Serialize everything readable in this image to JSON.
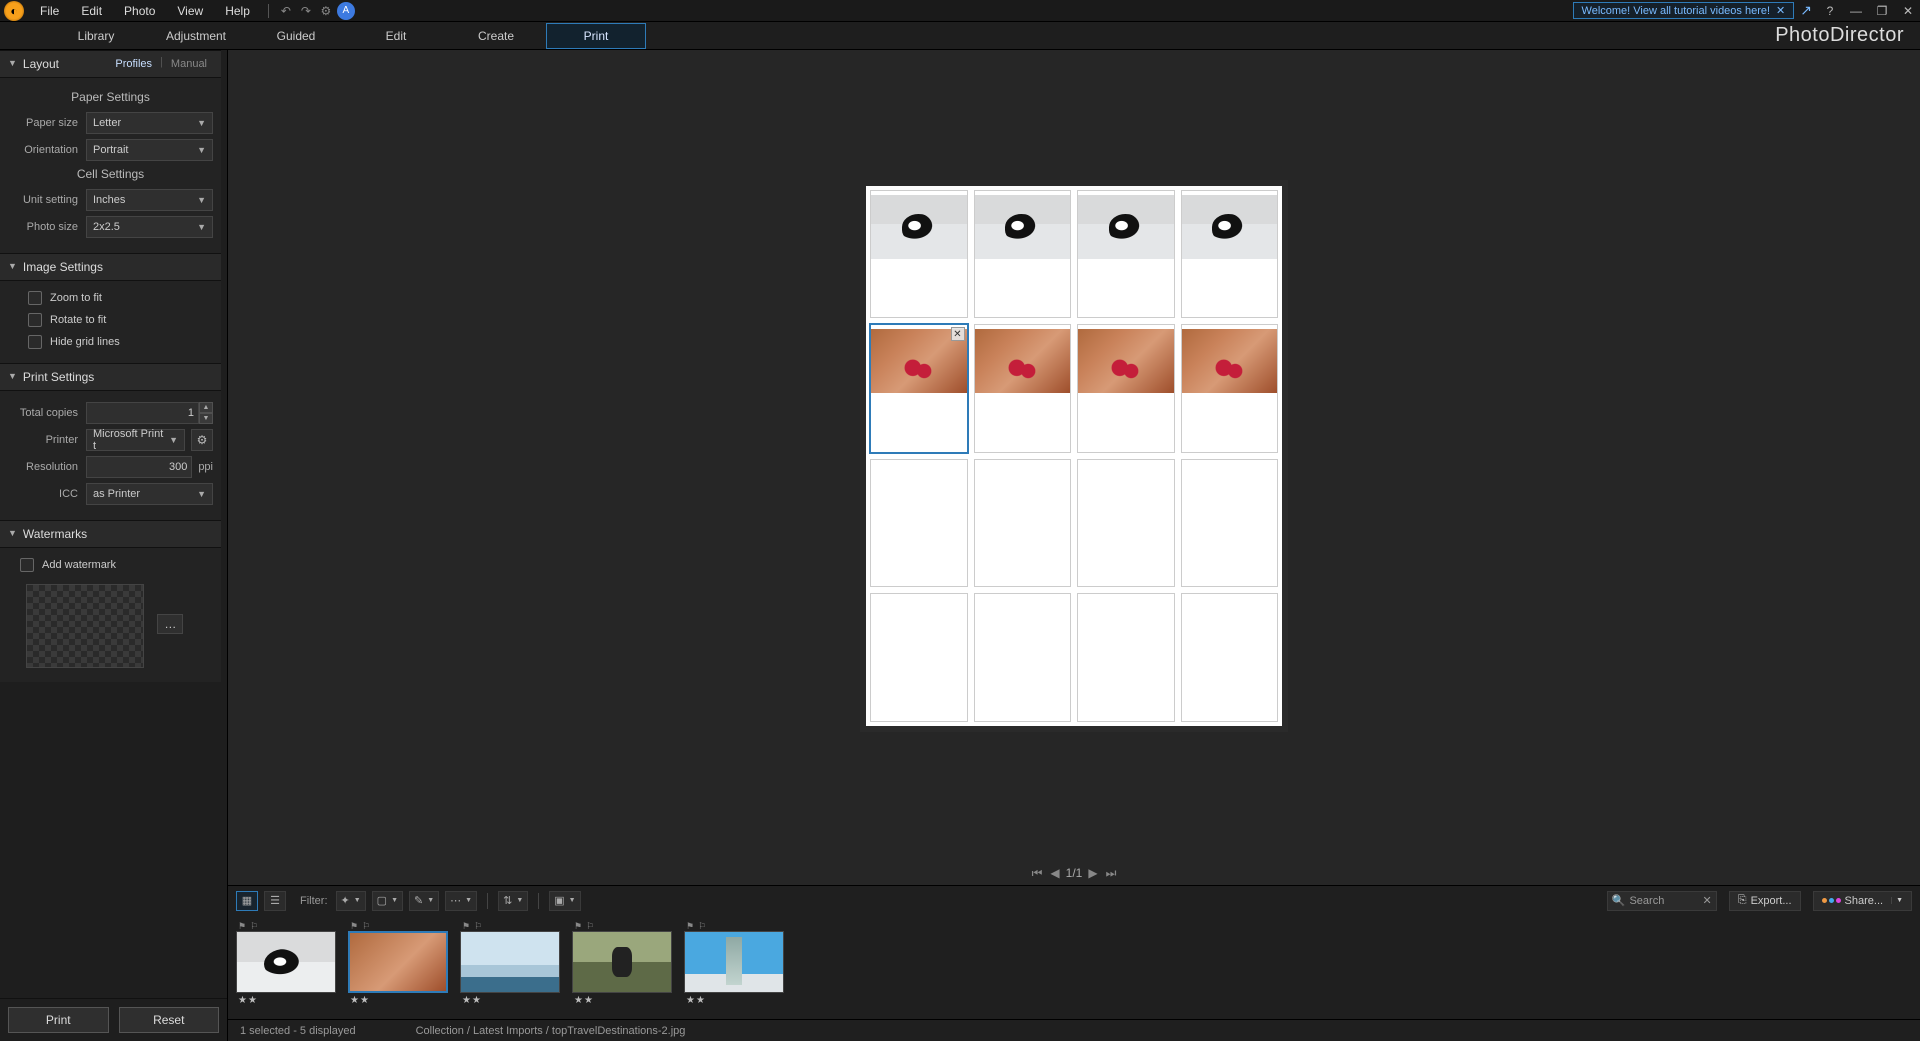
{
  "menubar": {
    "items": [
      "File",
      "Edit",
      "Photo",
      "View",
      "Help"
    ],
    "tutorial_pill": "Welcome! View all tutorial videos here!"
  },
  "modules": {
    "tabs": [
      "Library",
      "Adjustment",
      "Guided",
      "Edit",
      "Create",
      "Print"
    ],
    "active": "Print",
    "brand": "PhotoDirector"
  },
  "left": {
    "layout": {
      "title": "Layout",
      "subtabs": {
        "profiles": "Profiles",
        "manual": "Manual",
        "active": "Profiles"
      },
      "paper_settings_heading": "Paper Settings",
      "paper_size": {
        "label": "Paper size",
        "value": "Letter"
      },
      "orientation": {
        "label": "Orientation",
        "value": "Portrait"
      },
      "cell_settings_heading": "Cell Settings",
      "unit_setting": {
        "label": "Unit setting",
        "value": "Inches"
      },
      "photo_size": {
        "label": "Photo size",
        "value": "2x2.5"
      }
    },
    "image": {
      "title": "Image Settings",
      "zoom": {
        "label": "Zoom to fit",
        "checked": false
      },
      "rotate": {
        "label": "Rotate to fit",
        "checked": false
      },
      "hide_grid": {
        "label": "Hide grid lines",
        "checked": false
      }
    },
    "print": {
      "title": "Print Settings",
      "total_copies": {
        "label": "Total copies",
        "value": "1"
      },
      "printer": {
        "label": "Printer",
        "value": "Microsoft Print t"
      },
      "resolution": {
        "label": "Resolution",
        "value": "300",
        "unit": "ppi"
      },
      "icc": {
        "label": "ICC",
        "value": "as Printer"
      }
    },
    "watermarks": {
      "title": "Watermarks",
      "add": {
        "label": "Add watermark",
        "checked": false
      }
    },
    "buttons": {
      "print": "Print",
      "reset": "Reset"
    }
  },
  "preview": {
    "grid": {
      "cols": 4,
      "rows": 4
    },
    "cells": [
      {
        "r": 0,
        "c": 0,
        "photo": "penguin"
      },
      {
        "r": 0,
        "c": 1,
        "photo": "penguin"
      },
      {
        "r": 0,
        "c": 2,
        "photo": "penguin"
      },
      {
        "r": 0,
        "c": 3,
        "photo": "penguin"
      },
      {
        "r": 1,
        "c": 0,
        "photo": "camel",
        "selected": true,
        "has_close": true
      },
      {
        "r": 1,
        "c": 1,
        "photo": "camel"
      },
      {
        "r": 1,
        "c": 2,
        "photo": "camel"
      },
      {
        "r": 1,
        "c": 3,
        "photo": "camel"
      },
      {
        "r": 2,
        "c": 0,
        "photo": null
      },
      {
        "r": 2,
        "c": 1,
        "photo": null
      },
      {
        "r": 2,
        "c": 2,
        "photo": null
      },
      {
        "r": 2,
        "c": 3,
        "photo": null
      },
      {
        "r": 3,
        "c": 0,
        "photo": null
      },
      {
        "r": 3,
        "c": 1,
        "photo": null
      },
      {
        "r": 3,
        "c": 2,
        "photo": null
      },
      {
        "r": 3,
        "c": 3,
        "photo": null
      }
    ],
    "page_label": "1/1"
  },
  "filmstrip": {
    "filter_label": "Filter:",
    "search_placeholder": "Search",
    "export_label": "Export...",
    "share_label": "Share...",
    "thumbs": [
      {
        "img": "penguin",
        "stars": "★★",
        "selected": false
      },
      {
        "img": "camel",
        "stars": "★★",
        "selected": true
      },
      {
        "img": "glacier",
        "stars": "★★",
        "selected": false
      },
      {
        "img": "rock",
        "stars": "★★",
        "selected": false
      },
      {
        "img": "tower",
        "stars": "★★",
        "selected": false
      }
    ]
  },
  "status": {
    "selection": "1 selected - 5 displayed",
    "path": "Collection / Latest Imports / topTravelDestinations-2.jpg"
  }
}
